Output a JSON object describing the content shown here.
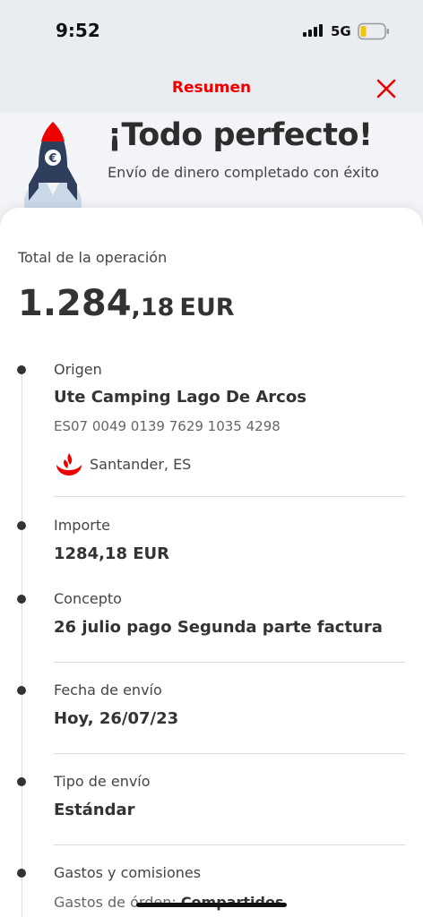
{
  "status_bar": {
    "time": "9:52",
    "network": "5G"
  },
  "header": {
    "title": "Resumen"
  },
  "hero": {
    "title": "¡Todo perfecto!",
    "subtitle": "Envío de dinero completado con éxito"
  },
  "total": {
    "label": "Total de la operación",
    "amount_int": "1.284",
    "amount_dec": ",18",
    "currency": "EUR"
  },
  "origin": {
    "label": "Origen",
    "name": "Ute Camping Lago De Arcos",
    "iban": "ES07 0049 0139 7629 1035 4298",
    "bank": "Santander, ES"
  },
  "amount": {
    "label": "Importe",
    "value": "1284,18 EUR"
  },
  "concept": {
    "label": "Concepto",
    "value": "26 julio pago Segunda parte factura"
  },
  "date": {
    "label": "Fecha de envío",
    "value": "Hoy, 26/07/23"
  },
  "transfer_type": {
    "label": "Tipo de envío",
    "value": "Estándar"
  },
  "fees": {
    "label": "Gastos y comisiones",
    "prefix": "Gastos de órden: ",
    "value": "Compartidos"
  },
  "colors": {
    "brand_red": "#ec0000",
    "rocket_navy": "#2e3f5e"
  }
}
